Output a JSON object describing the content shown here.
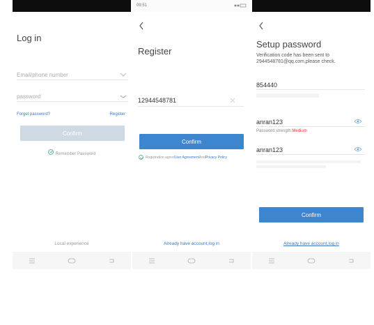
{
  "login": {
    "title": "Log in",
    "email_placeholder": "Email/phone number",
    "password_placeholder": "password",
    "forgot_password": "Forget password?",
    "register_link": "Register",
    "confirm_label": "Confirm",
    "remember_password": "Remember Password",
    "local_experience": "Local experience"
  },
  "register": {
    "status_time": "09:51",
    "title": "Register",
    "phone_value": "12944548781",
    "confirm_label": "Confirm",
    "agreement_text": "Registration agree",
    "agreement_link": "User Agreement",
    "agreement_and": "And",
    "privacy_link": "Privacy Policy",
    "already_account": "Already have account,log in"
  },
  "setup": {
    "title": "Setup password",
    "info_line1": "Verification code has been sent to",
    "info_line2": "2944548781@qq.com,please check.",
    "code_value": "854440",
    "password_value": "anran123",
    "strength_label": "Password strength:",
    "strength_value": "Medium",
    "confirm_password_value": "anran123",
    "confirm_label": "Confirm",
    "already_account": "Already have account,log in"
  },
  "colors": {
    "primary": "#3d86cf",
    "disabled": "#cfd9e4",
    "link": "#3a78c6",
    "strength_medium": "#d9342b"
  }
}
